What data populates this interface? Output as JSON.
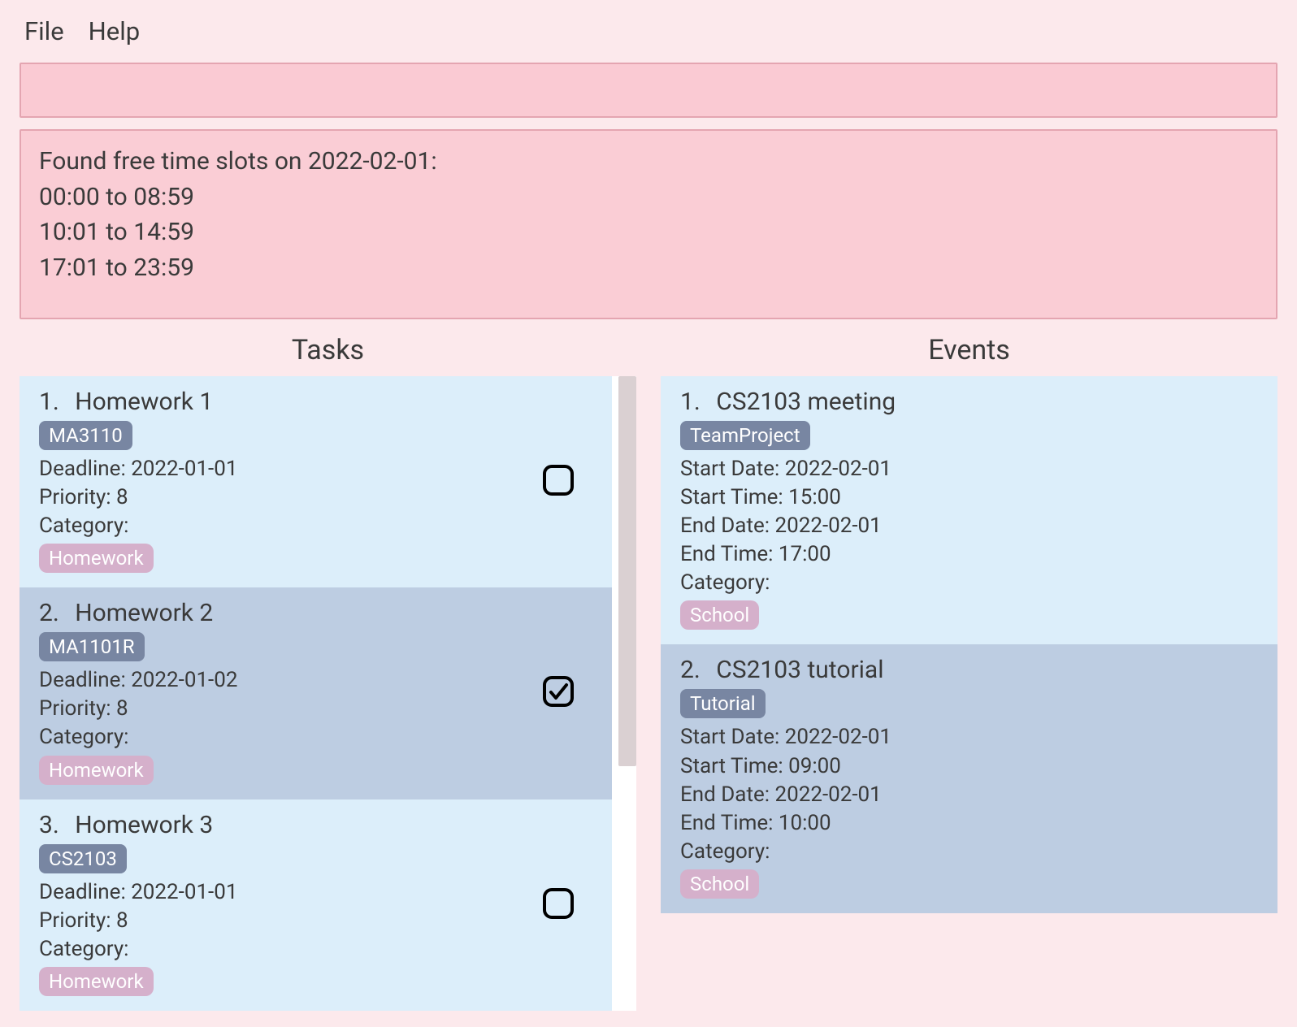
{
  "menu": {
    "file": "File",
    "help": "Help"
  },
  "result": "Found free time slots on 2022-02-01:\n00:00 to 08:59\n10:01 to 14:59\n17:01 to 23:59",
  "headers": {
    "tasks": "Tasks",
    "events": "Events"
  },
  "labels": {
    "deadline": "Deadline: ",
    "priority": "Priority: ",
    "category": "Category:",
    "startDate": "Start Date: ",
    "startTime": "Start Time: ",
    "endDate": "End Date: ",
    "endTime": "End Time: "
  },
  "tasks": [
    {
      "num": "1.",
      "title": "Homework 1",
      "tag": "MA3110",
      "deadline": "2022-01-01",
      "priority": "8",
      "category": "Homework",
      "checked": false,
      "shade": "light"
    },
    {
      "num": "2.",
      "title": "Homework 2",
      "tag": "MA1101R",
      "deadline": "2022-01-02",
      "priority": "8",
      "category": "Homework",
      "checked": true,
      "shade": "dark"
    },
    {
      "num": "3.",
      "title": "Homework 3",
      "tag": "CS2103",
      "deadline": "2022-01-01",
      "priority": "8",
      "category": "Homework",
      "checked": false,
      "shade": "light"
    }
  ],
  "events": [
    {
      "num": "1.",
      "title": "CS2103 meeting",
      "tag": "TeamProject",
      "startDate": "2022-02-01",
      "startTime": "15:00",
      "endDate": "2022-02-01",
      "endTime": "17:00",
      "category": "School",
      "shade": "light"
    },
    {
      "num": "2.",
      "title": "CS2103 tutorial",
      "tag": "Tutorial",
      "startDate": "2022-02-01",
      "startTime": "09:00",
      "endDate": "2022-02-01",
      "endTime": "10:00",
      "category": "School",
      "shade": "dark"
    }
  ]
}
